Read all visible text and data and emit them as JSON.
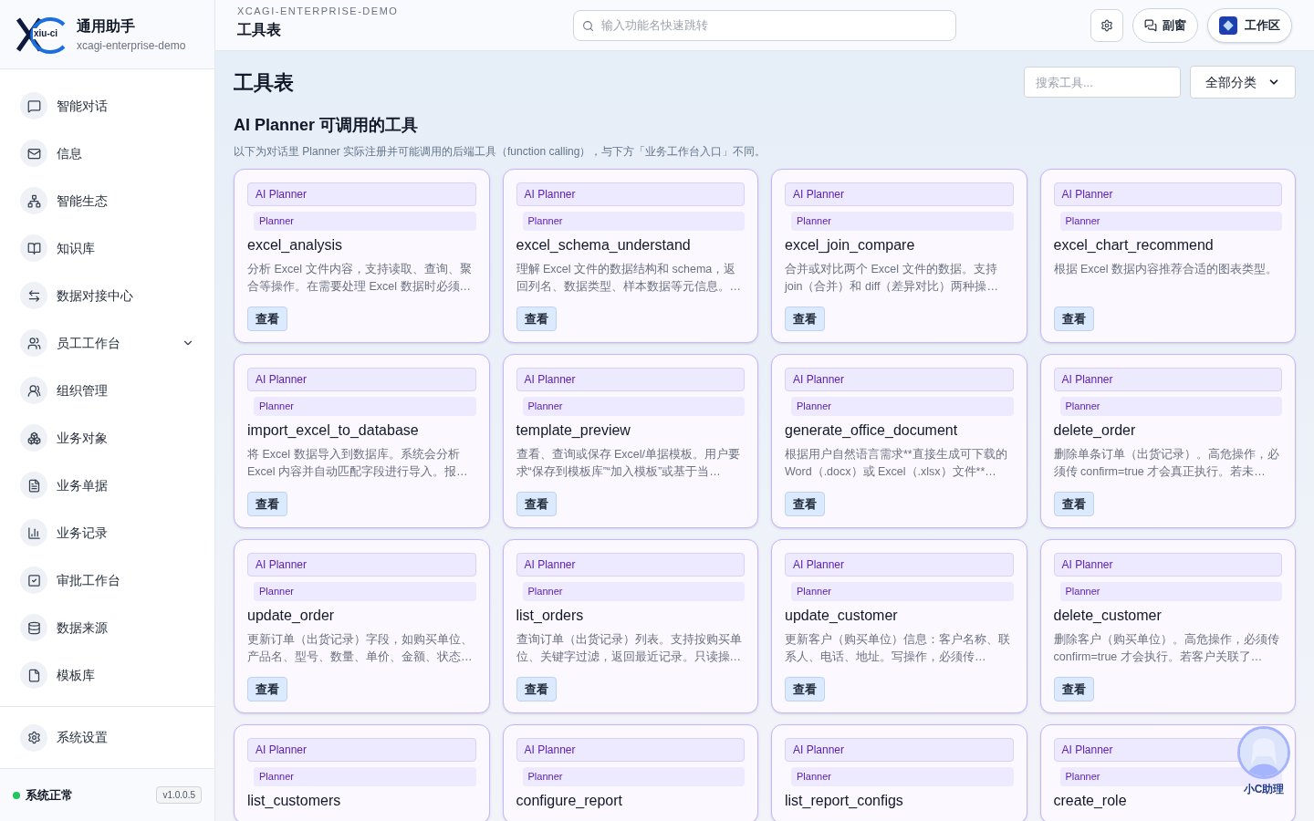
{
  "brand": {
    "logo_text": "xiu-ci",
    "name": "通用助手",
    "subtitle": "xcagi-enterprise-demo"
  },
  "sidebar": {
    "items": [
      {
        "label": "智能对话",
        "kind": "link"
      },
      {
        "label": "信息",
        "kind": "link"
      },
      {
        "label": "智能生态",
        "kind": "link"
      },
      {
        "label": "知识库",
        "kind": "link"
      },
      {
        "label": "数据对接中心",
        "kind": "link"
      },
      {
        "label": "员工工作台",
        "kind": "group"
      },
      {
        "label": "组织管理",
        "kind": "link"
      },
      {
        "label": "业务对象",
        "kind": "link"
      },
      {
        "label": "业务单据",
        "kind": "link"
      },
      {
        "label": "业务记录",
        "kind": "link"
      },
      {
        "label": "审批工作台",
        "kind": "link"
      },
      {
        "label": "数据来源",
        "kind": "link"
      },
      {
        "label": "模板库",
        "kind": "link"
      }
    ],
    "settings": "系统设置",
    "status": {
      "label": "系统正常",
      "online": true,
      "version": "v1.0.0.5"
    }
  },
  "header": {
    "breadcrumb": "XCAGI-ENTERPRISE-DEMO",
    "title": "工具表",
    "search_placeholder": "输入功能名快速跳转",
    "buttons": [
      "副窗",
      "工作区"
    ]
  },
  "page": {
    "title": "工具表",
    "search_placeholder": "搜索工具...",
    "category": "全部分类",
    "section_title": "AI Planner 可调用的工具",
    "section_note": "以下为对话里 Planner 实际注册并可能调用的后端工具（function calling），与下方「业务工作台入口」不同。",
    "tools": [
      {
        "tag": "AI Planner",
        "sub_tag": "Planner",
        "name": "excel_analysis",
        "description": "分析 Excel 文件内容，支持读取、查询、聚合等操作。在需要处理 Excel 数据时必须…",
        "action": "查看"
      },
      {
        "tag": "AI Planner",
        "sub_tag": "Planner",
        "name": "excel_schema_understand",
        "description": "理解 Excel 文件的数据结构和 schema，返回列名、数据类型、样本数据等元信息。…",
        "action": "查看"
      },
      {
        "tag": "AI Planner",
        "sub_tag": "Planner",
        "name": "excel_join_compare",
        "description": "合并或对比两个 Excel 文件的数据。支持 join（合并）和 diff（差异对比）两种操…",
        "action": "查看"
      },
      {
        "tag": "AI Planner",
        "sub_tag": "Planner",
        "name": "excel_chart_recommend",
        "description": "根据 Excel 数据内容推荐合适的图表类型。",
        "action": "查看"
      },
      {
        "tag": "AI Planner",
        "sub_tag": "Planner",
        "name": "import_excel_to_database",
        "description": "将 Excel 数据导入到数据库。系统会分析 Excel 内容并自动匹配字段进行导入。报…",
        "action": "查看"
      },
      {
        "tag": "AI Planner",
        "sub_tag": "Planner",
        "name": "template_preview",
        "description": "查看、查询或保存 Excel/单据模板。用户要求“保存到模板库”“加入模板”或基于当…",
        "action": "查看"
      },
      {
        "tag": "AI Planner",
        "sub_tag": "Planner",
        "name": "generate_office_document",
        "description": "根据用户自然语言需求**直接生成可下载的 Word（.docx）或 Excel（.xlsx）文件**…",
        "action": "查看"
      },
      {
        "tag": "AI Planner",
        "sub_tag": "Planner",
        "name": "delete_order",
        "description": "删除单条订单（出货记录）。高危操作，必须传 confirm=true 才会真正执行。若未…",
        "action": "查看"
      },
      {
        "tag": "AI Planner",
        "sub_tag": "Planner",
        "name": "update_order",
        "description": "更新订单（出货记录）字段，如购买单位、产品名、型号、数量、单价、金额、状态…",
        "action": "查看"
      },
      {
        "tag": "AI Planner",
        "sub_tag": "Planner",
        "name": "list_orders",
        "description": "查询订单（出货记录）列表。支持按购买单位、关键字过滤，返回最近记录。只读操…",
        "action": "查看"
      },
      {
        "tag": "AI Planner",
        "sub_tag": "Planner",
        "name": "update_customer",
        "description": "更新客户（购买单位）信息：客户名称、联系人、电话、地址。写操作，必须传…",
        "action": "查看"
      },
      {
        "tag": "AI Planner",
        "sub_tag": "Planner",
        "name": "delete_customer",
        "description": "删除客户（购买单位）。高危操作，必须传 confirm=true 才会执行。若客户关联了…",
        "action": "查看"
      },
      {
        "tag": "AI Planner",
        "sub_tag": "Planner",
        "name": "list_customers"
      },
      {
        "tag": "AI Planner",
        "sub_tag": "Planner",
        "name": "configure_report"
      },
      {
        "tag": "AI Planner",
        "sub_tag": "Planner",
        "name": "list_report_configs"
      },
      {
        "tag": "AI Planner",
        "sub_tag": "Planner",
        "name": "create_role"
      }
    ]
  },
  "assistant": {
    "label": "小C助理"
  }
}
